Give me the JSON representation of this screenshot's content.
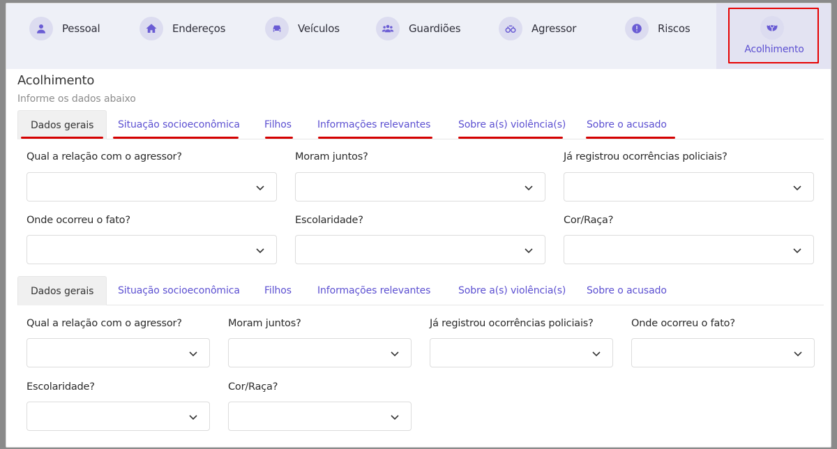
{
  "nav": {
    "items": [
      {
        "label": "Pessoal",
        "icon": "user-icon"
      },
      {
        "label": "Endereços",
        "icon": "home-icon"
      },
      {
        "label": "Veículos",
        "icon": "car-icon"
      },
      {
        "label": "Guardiões",
        "icon": "users-icon"
      },
      {
        "label": "Agressor",
        "icon": "handcuffs-icon"
      },
      {
        "label": "Riscos",
        "icon": "alert-icon"
      }
    ],
    "active": {
      "label": "Acolhimento",
      "icon": "hands-icon"
    }
  },
  "section": {
    "title": "Acolhimento",
    "subtitle": "Informe os dados abaixo"
  },
  "tabs": [
    "Dados gerais",
    "Situação socioeconômica",
    "Filhos",
    "Informações relevantes",
    "Sobre a(s) violência(s)",
    "Sobre o acusado"
  ],
  "fields": [
    "Qual a relação com o agressor?",
    "Moram juntos?",
    "Já registrou ocorrências policiais?",
    "Onde ocorreu o fato?",
    "Escolaridade?",
    "Cor/Raça?"
  ],
  "colors": {
    "accent": "#5b4fd1",
    "highlight": "#e60000"
  }
}
